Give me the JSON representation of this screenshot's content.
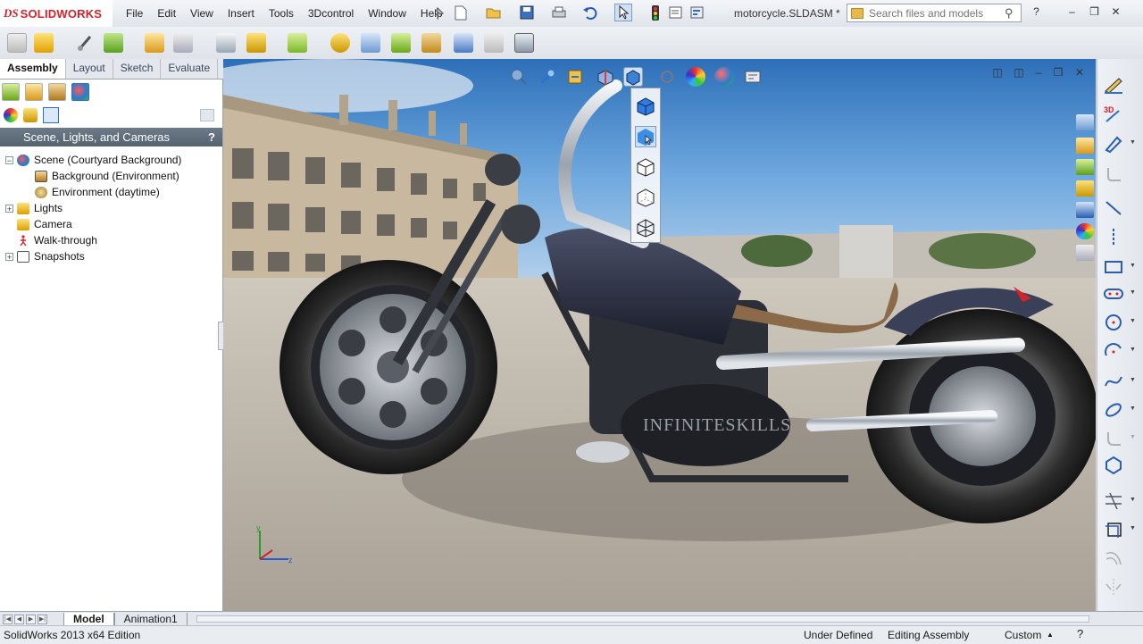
{
  "app": {
    "brand_prefix": "DS",
    "brand_name": "SOLIDWORKS",
    "document_title": "motorcycle.SLDASM *"
  },
  "menu": {
    "items": [
      "File",
      "Edit",
      "View",
      "Insert",
      "Tools",
      "3Dcontrol",
      "Window",
      "Help"
    ]
  },
  "search": {
    "placeholder": "Search files and models"
  },
  "window_controls": [
    "?",
    "–",
    "❐",
    "✕"
  ],
  "command_manager_tabs": [
    {
      "label": "Assembly",
      "active": true
    },
    {
      "label": "Layout",
      "active": false
    },
    {
      "label": "Sketch",
      "active": false
    },
    {
      "label": "Evaluate",
      "active": false
    }
  ],
  "panel": {
    "title": "Scene, Lights, and Cameras",
    "help": "?",
    "tree": [
      {
        "label": "Scene (Courtyard Background)",
        "expander": "−",
        "level": 0
      },
      {
        "label": "Background (Environment)",
        "expander": "",
        "level": 1
      },
      {
        "label": "Environment (daytime)",
        "expander": "",
        "level": 1
      },
      {
        "label": "Lights",
        "expander": "+",
        "level": 0
      },
      {
        "label": "Camera",
        "expander": "",
        "level": 0
      },
      {
        "label": "Walk-through",
        "expander": "",
        "level": 0
      },
      {
        "label": "Snapshots",
        "expander": "+",
        "level": 0
      }
    ]
  },
  "bottom_tabs": [
    {
      "label": "Model",
      "active": true
    },
    {
      "label": "Animation1",
      "active": false
    }
  ],
  "status": {
    "edition": "SolidWorks 2013 x64 Edition",
    "sketch_state": "Under Defined",
    "mode": "Editing Assembly",
    "units": "Custom",
    "units_arrow": "▲"
  },
  "viewport": {
    "engraving": "INFINITESKILLS",
    "triad_axes": [
      "y",
      "z"
    ]
  },
  "colors": {
    "accent_red": "#d2232a",
    "panel_header": "#5f6c79",
    "selection_blue": "#2a6fd1"
  }
}
